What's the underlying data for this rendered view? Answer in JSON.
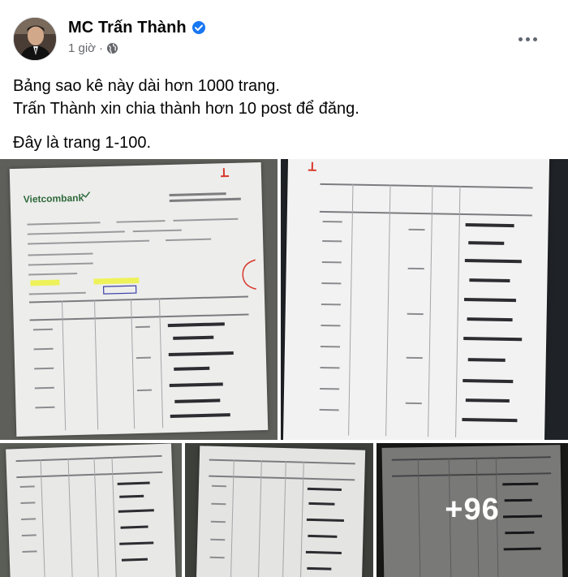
{
  "post": {
    "author": "MC Trấn Thành",
    "time": "1 giờ",
    "meta_separator": "·",
    "verified": true,
    "icons": [
      "verified-badge-icon",
      "globe-icon",
      "more-options-icon"
    ],
    "lines": [
      "Bảng sao kê này dài hơn 1000 trang.",
      "Trấn Thành xin chia thành hơn 10 post để đăng.",
      "Đây là trang 1-100."
    ]
  },
  "media": {
    "bank_logo": "Vietcombank",
    "more_count": "+96"
  },
  "colors": {
    "verified_blue": "#1877f2",
    "meta_gray": "#65676b",
    "highlight_yellow": "#eef25a",
    "stamp_red": "#d7382b"
  }
}
